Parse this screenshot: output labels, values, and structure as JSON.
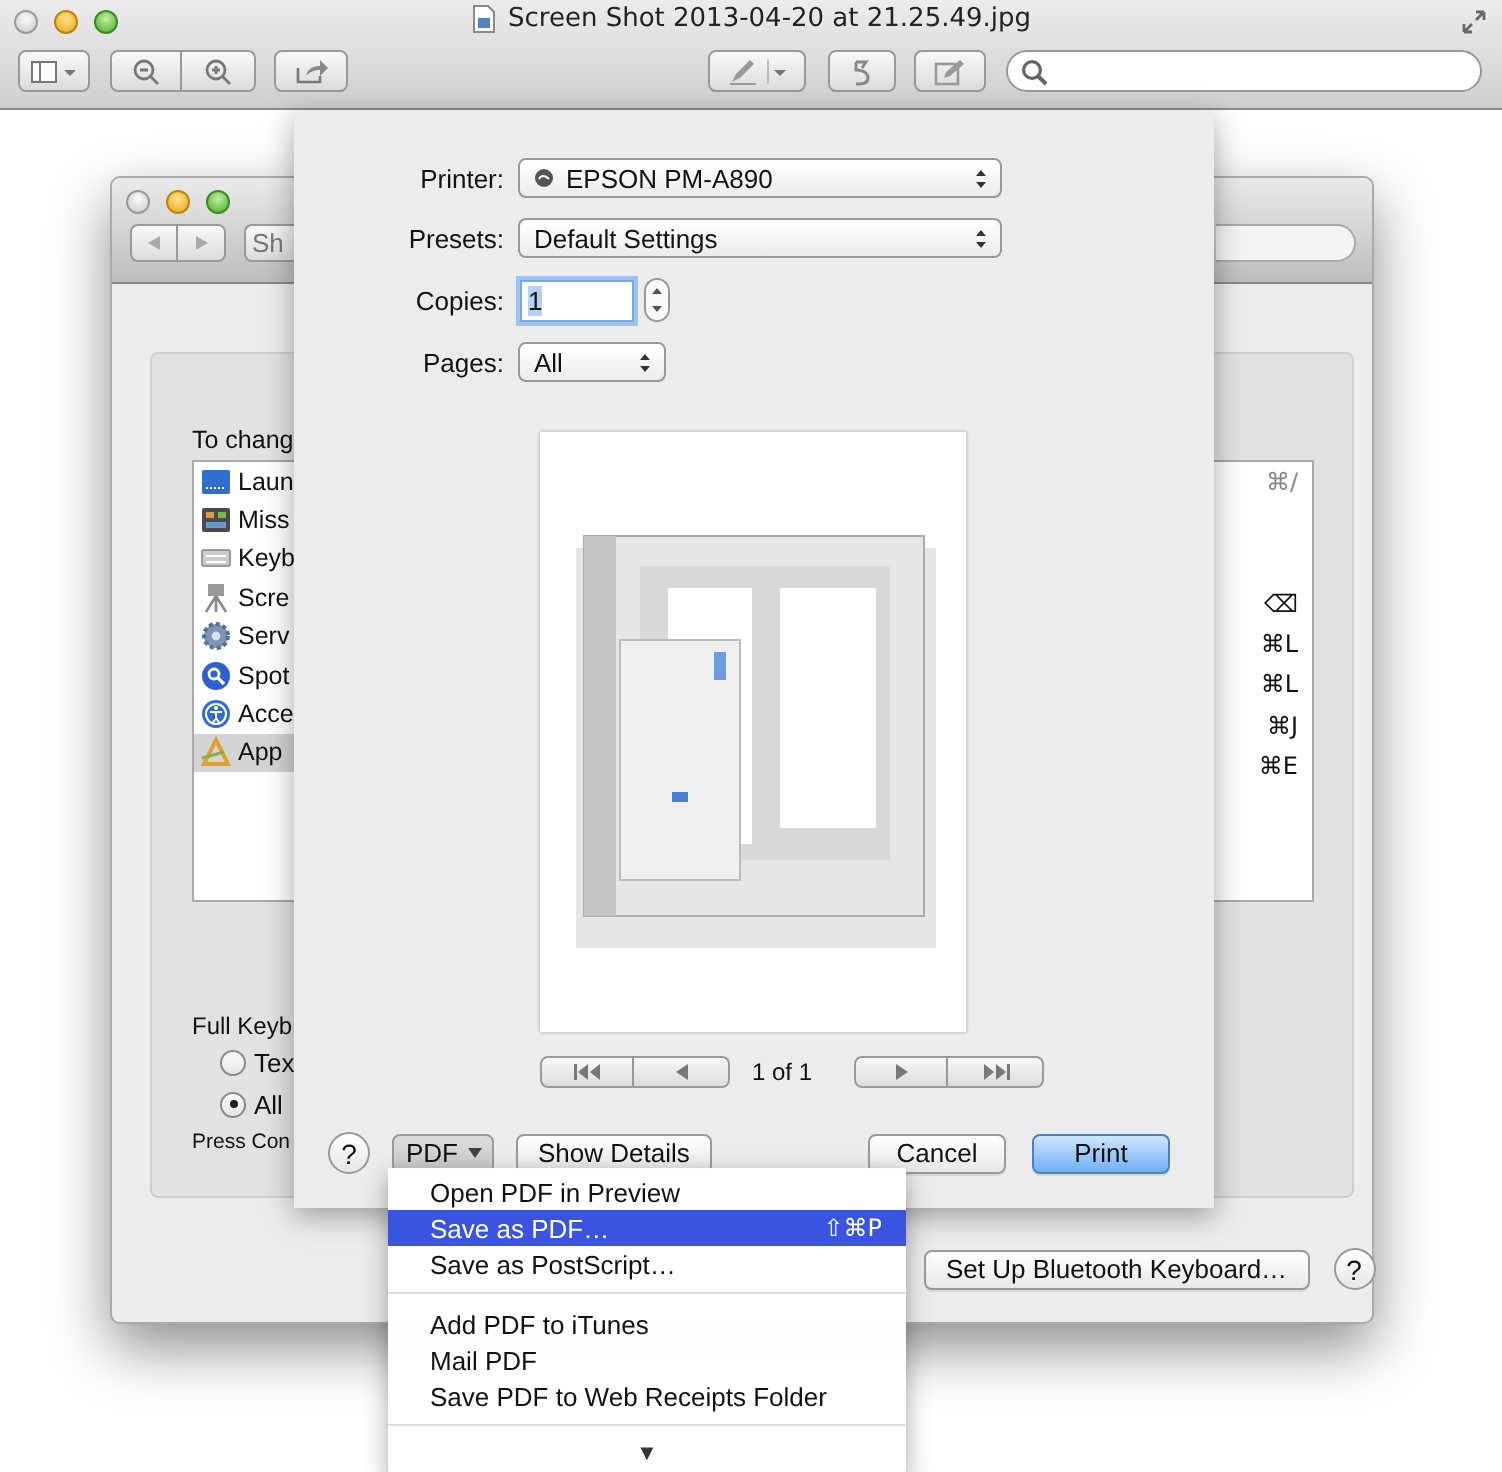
{
  "viewer": {
    "title": "Screen Shot 2013-04-20 at 21.25.49.jpg"
  },
  "keyboard_window": {
    "show_all": "Sh",
    "intro": "To chang",
    "list": [
      {
        "label": "Laun",
        "selected": false
      },
      {
        "label": "Miss",
        "selected": false
      },
      {
        "label": "Keyb",
        "selected": false
      },
      {
        "label": "Scre",
        "selected": false
      },
      {
        "label": "Serv",
        "selected": false
      },
      {
        "label": "Spot",
        "selected": false
      },
      {
        "label": "Acce",
        "selected": false
      },
      {
        "label": "App",
        "selected": true
      }
    ],
    "shortcuts": [
      "⌘/",
      "⌫",
      "⌘L",
      "⌘L",
      "⌘J",
      "⌘E"
    ],
    "full_access_label": "Full Keyb",
    "options": [
      {
        "label": "Tex",
        "selected": false
      },
      {
        "label": "All",
        "selected": true
      }
    ],
    "hint": "Press Con",
    "bluetooth_button": "Set Up Bluetooth Keyboard…",
    "help": "?"
  },
  "print_sheet": {
    "fields": [
      {
        "kind": "printer",
        "label": "Printer:",
        "value": "EPSON PM-A890"
      },
      {
        "kind": "popup",
        "label": "Presets:",
        "value": "Default Settings"
      },
      {
        "kind": "stepper",
        "label": "Copies:",
        "value": "1"
      },
      {
        "kind": "small-popup",
        "label": "Pages:",
        "value": "All"
      }
    ],
    "page_count": "1 of 1",
    "left_buttons": [
      {
        "kind": "help",
        "label": "?"
      },
      {
        "kind": "menu",
        "label": "PDF"
      },
      {
        "kind": "push",
        "label": "Show Details"
      }
    ],
    "right_buttons": [
      {
        "kind": "push",
        "label": "Cancel",
        "default": false
      },
      {
        "kind": "push",
        "label": "Print",
        "default": true
      }
    ]
  },
  "pdf_menu": {
    "items": [
      {
        "kind": "item",
        "label": "Open PDF in Preview",
        "selected": false
      },
      {
        "kind": "item",
        "label": "Save as PDF…",
        "shortcut": "⇧⌘P",
        "selected": true
      },
      {
        "kind": "item",
        "label": "Save as PostScript…",
        "selected": false
      },
      {
        "kind": "separator"
      },
      {
        "kind": "item",
        "label": "Add PDF to iTunes",
        "selected": false
      },
      {
        "kind": "item",
        "label": "Mail PDF",
        "selected": false
      },
      {
        "kind": "item",
        "label": "Save PDF to Web Receipts Folder",
        "selected": false
      },
      {
        "kind": "separator"
      },
      {
        "kind": "more",
        "label": "▼"
      }
    ]
  }
}
